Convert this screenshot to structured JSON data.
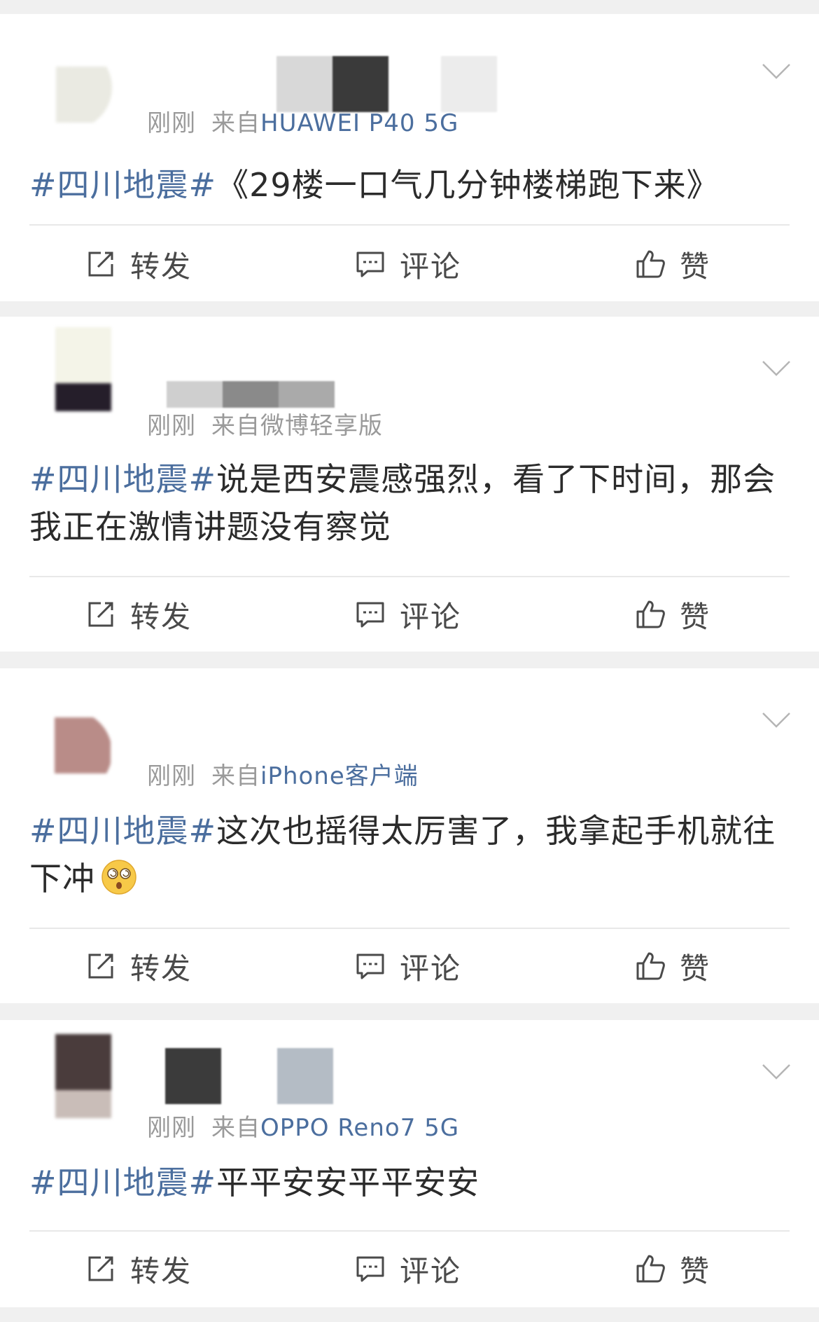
{
  "colors": {
    "topic_link": "#4b6e9e",
    "meta_gray": "#9a9a9a",
    "body_text": "#2b2b2b",
    "page_background": "#f0f0f0"
  },
  "actions": {
    "repost_label": "转发",
    "comment_label": "评论",
    "like_label": "赞"
  },
  "posts": [
    {
      "time": "刚刚",
      "from_prefix": "来自",
      "source": "HUAWEI P40 5G",
      "topic": "#四川地震#",
      "text": "《29楼一口气几分钟楼梯跑下来》"
    },
    {
      "time": "刚刚",
      "from_prefix": "来自",
      "source": "微博轻享版",
      "topic": "#四川地震#",
      "text": "说是西安震感强烈，看了下时间，那会我正在激情讲题没有察觉"
    },
    {
      "time": "刚刚",
      "from_prefix": "来自",
      "source": "iPhone客户端",
      "topic": "#四川地震#",
      "text": "这次也摇得太厉害了，我拿起手机就往下冲",
      "emoji": "dizzy-face-emoji"
    },
    {
      "time": "刚刚",
      "from_prefix": "来自",
      "source": "OPPO Reno7 5G",
      "topic": "#四川地震#",
      "text": "平平安安平平安安"
    }
  ]
}
